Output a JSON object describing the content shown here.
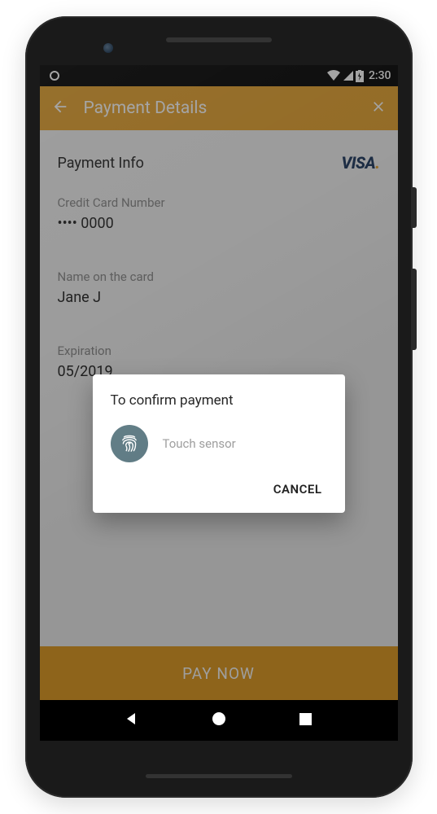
{
  "status": {
    "time": "2:30"
  },
  "appbar": {
    "title": "Payment Details"
  },
  "content": {
    "section_title": "Payment Info",
    "card_brand": "VISA",
    "cc_label": "Credit Card Number",
    "cc_value": "•••• 0000",
    "name_label": "Name on the card",
    "name_value": "Jane J",
    "exp_label": "Expiration",
    "exp_value": "05/2019"
  },
  "pay_button": "PAY NOW",
  "dialog": {
    "title": "To confirm payment",
    "hint": "Touch sensor",
    "cancel": "CANCEL"
  },
  "colors": {
    "accent": "#e6a22c"
  }
}
